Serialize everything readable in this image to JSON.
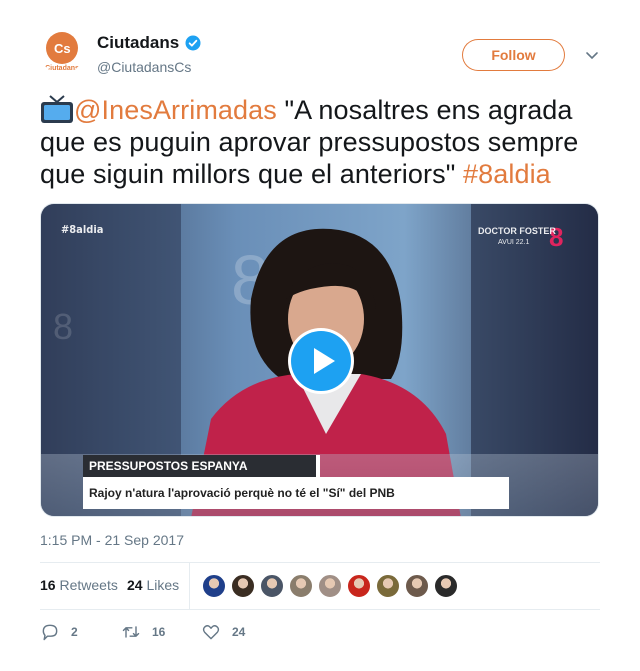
{
  "user": {
    "display_name": "Ciutadans",
    "handle": "@CiutadansCs",
    "avatar_text": "Cs",
    "avatar_caption": "Ciutadans",
    "brand_color": "#e27b3e",
    "verified_color": "#1da1f2"
  },
  "follow_label": "Follow",
  "tweet": {
    "mention": "@InesArrimadas",
    "text": " \"A nosaltres ens agrada que es puguin aprovar pressupostos sempre que siguin millors que el anteriors\" ",
    "hashtag": "#8aldia"
  },
  "video": {
    "hashtag_overlay": "#8aldia",
    "show_overlay": "DOCTOR FOSTER",
    "show_overlay_sub": "AVUI 22.1",
    "headline": "PRESSUPOSTOS ESPANYA",
    "caption": "Rajoy n'atura l'aprovació perquè no té el \"Sí\" del PNB"
  },
  "timestamp": "1:15 PM - 21 Sep 2017",
  "stats": {
    "retweets_count": "16",
    "retweets_label": "Retweets",
    "likes_count": "24",
    "likes_label": "Likes"
  },
  "likers": [
    {
      "icon": "avatar-1",
      "color": "#1f3f8a"
    },
    {
      "icon": "avatar-2",
      "color": "#3a2d22"
    },
    {
      "icon": "avatar-3",
      "color": "#4a5566"
    },
    {
      "icon": "avatar-4",
      "color": "#8a7d6c"
    },
    {
      "icon": "avatar-5",
      "color": "#a08f86"
    },
    {
      "icon": "avatar-6",
      "color": "#c8261c"
    },
    {
      "icon": "avatar-7",
      "color": "#7a6a3a"
    },
    {
      "icon": "avatar-8",
      "color": "#6d5a4c"
    },
    {
      "icon": "avatar-9",
      "color": "#2a2a2a"
    }
  ],
  "actions": {
    "replies": "2",
    "retweets": "16",
    "likes": "24"
  }
}
